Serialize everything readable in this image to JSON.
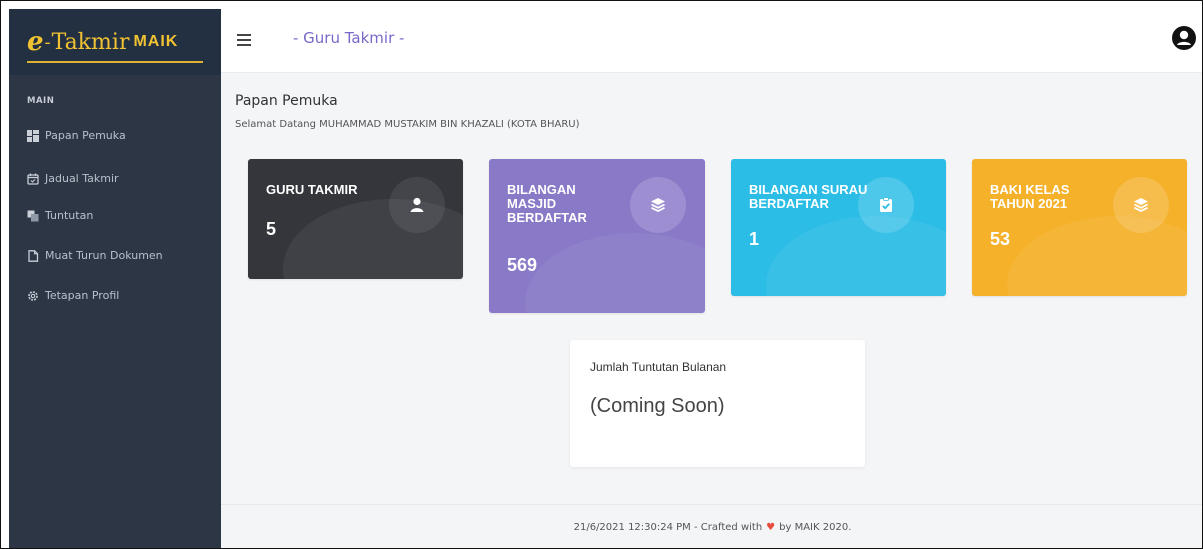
{
  "logo": {
    "e": "e",
    "dash": "-",
    "takmir": "Takmir",
    "maik": "MAIK"
  },
  "sidebar": {
    "section": "MAIN",
    "items": [
      {
        "label": "Papan Pemuka",
        "icon": "dashboard-icon"
      },
      {
        "label": "Jadual Takmir",
        "icon": "calendar-icon"
      },
      {
        "label": "Tuntutan",
        "icon": "copy-icon"
      },
      {
        "label": "Muat Turun Dokumen",
        "icon": "file-icon"
      },
      {
        "label": "Tetapan Profil",
        "icon": "gear-icon"
      }
    ]
  },
  "header": {
    "title": "- Guru Takmir -",
    "menu_icon": "hamburger-icon",
    "user_icon": "user-circle-icon"
  },
  "page": {
    "title": "Papan Pemuka",
    "welcome": "Selamat Datang MUHAMMAD MUSTAKIM BIN KHAZALI (KOTA BHARU)"
  },
  "cards": [
    {
      "label": "GURU TAKMIR",
      "value": "5",
      "color": "#34363b",
      "icon": "user-icon"
    },
    {
      "label": "BILANGAN MASJID BERDAFTAR",
      "value": "569",
      "color": "#8979c7",
      "icon": "layers-icon"
    },
    {
      "label": "BILANGAN SURAU BERDAFTAR",
      "value": "1",
      "color": "#2cbde6",
      "icon": "clipboard-check-icon"
    },
    {
      "label": "BAKI KELAS TAHUN 2021",
      "value": "53",
      "color": "#f5b12a",
      "icon": "layers-icon"
    }
  ],
  "monthly": {
    "title": "Jumlah Tuntutan Bulanan",
    "value": "(Coming Soon)"
  },
  "footer": {
    "prefix": "21/6/2021 12:30:24 PM - Crafted with",
    "heart": "♥",
    "suffix": "by MAIK 2020."
  }
}
